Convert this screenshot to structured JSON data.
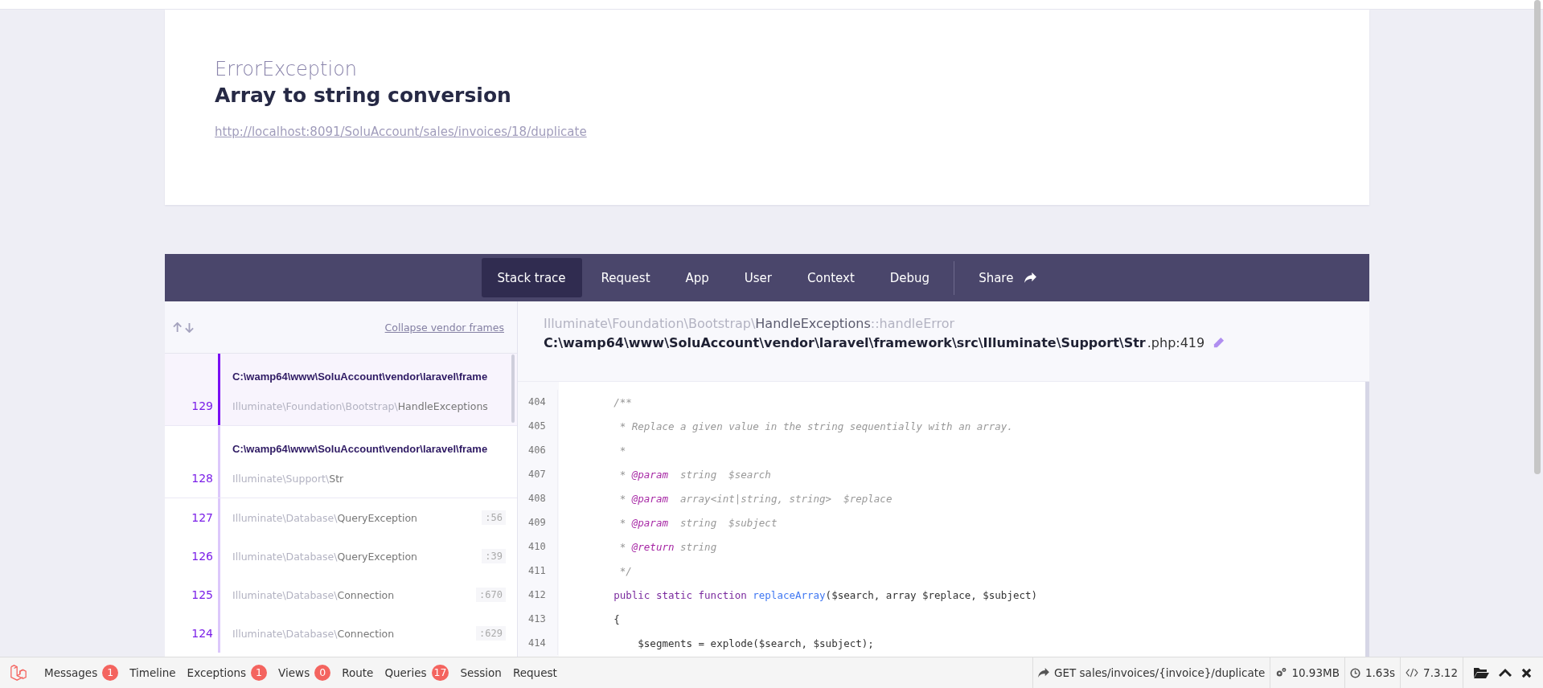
{
  "exception": {
    "class": "ErrorException",
    "message": "Array to string conversion",
    "url": "http://localhost:8091/SoluAccount/sales/invoices/18/duplicate"
  },
  "tabs": [
    {
      "label": "Stack trace",
      "selected": true
    },
    {
      "label": "Request",
      "selected": false
    },
    {
      "label": "App",
      "selected": false
    },
    {
      "label": "User",
      "selected": false
    },
    {
      "label": "Context",
      "selected": false
    },
    {
      "label": "Debug",
      "selected": false
    }
  ],
  "share": {
    "label": "Share"
  },
  "stack": {
    "collapse_link": "Collapse vendor frames",
    "frames": [
      {
        "number": "129",
        "file": "C:\\wamp64\\www\\SoluAccount\\vendor\\laravel\\frame",
        "namespace": "Illuminate\\Foundation\\Bootstrap\\",
        "class": "HandleExceptions",
        "selected": true
      },
      {
        "number": "128",
        "file": "C:\\wamp64\\www\\SoluAccount\\vendor\\laravel\\frame",
        "namespace": "Illuminate\\Support\\",
        "class": "Str",
        "selected": false
      },
      {
        "number": "127",
        "namespace": "Illuminate\\Database\\",
        "class": "QueryException",
        "line": ":56",
        "selected": false
      },
      {
        "number": "126",
        "namespace": "Illuminate\\Database\\",
        "class": "QueryException",
        "line": ":39",
        "selected": false
      },
      {
        "number": "125",
        "namespace": "Illuminate\\Database\\",
        "class": "Connection",
        "line": ":670",
        "selected": false
      },
      {
        "number": "124",
        "namespace": "Illuminate\\Database\\",
        "class": "Connection",
        "line": ":629",
        "selected": false
      }
    ]
  },
  "source": {
    "namespace": "Illuminate\\Foundation\\Bootstrap\\",
    "class": "HandleExceptions",
    "method": "::handleError",
    "path": "C:\\wamp64\\www\\SoluAccount\\vendor\\laravel\\framework\\src\\Illuminate\\Support\\Str",
    "location": ".php:419",
    "lines": [
      {
        "number": "404",
        "tokens": [
          {
            "kind": "comment",
            "text": "        /**"
          }
        ]
      },
      {
        "number": "405",
        "tokens": [
          {
            "kind": "comment",
            "text": "         * Replace a given value in the string sequentially with an array."
          }
        ]
      },
      {
        "number": "406",
        "tokens": [
          {
            "kind": "comment",
            "text": "         *"
          }
        ]
      },
      {
        "number": "407",
        "tokens": [
          {
            "kind": "comment",
            "text": "         * "
          },
          {
            "kind": "tag",
            "text": "@param"
          },
          {
            "kind": "comment",
            "text": "  string  $search"
          }
        ]
      },
      {
        "number": "408",
        "tokens": [
          {
            "kind": "comment",
            "text": "         * "
          },
          {
            "kind": "tag",
            "text": "@param"
          },
          {
            "kind": "comment",
            "text": "  array<int|string, string>  $replace"
          }
        ]
      },
      {
        "number": "409",
        "tokens": [
          {
            "kind": "comment",
            "text": "         * "
          },
          {
            "kind": "tag",
            "text": "@param"
          },
          {
            "kind": "comment",
            "text": "  string  $subject"
          }
        ]
      },
      {
        "number": "410",
        "tokens": [
          {
            "kind": "comment",
            "text": "         * "
          },
          {
            "kind": "tag",
            "text": "@return"
          },
          {
            "kind": "comment",
            "text": " string"
          }
        ]
      },
      {
        "number": "411",
        "tokens": [
          {
            "kind": "comment",
            "text": "         */"
          }
        ]
      },
      {
        "number": "412",
        "tokens": [
          {
            "kind": "keyword",
            "text": "        public static function "
          },
          {
            "kind": "function",
            "text": "replaceArray"
          },
          {
            "kind": "plain",
            "text": "($search, array $replace, $subject)"
          }
        ]
      },
      {
        "number": "413",
        "tokens": [
          {
            "kind": "plain",
            "text": "        {"
          }
        ]
      },
      {
        "number": "414",
        "tokens": [
          {
            "kind": "plain",
            "text": "            $segments = explode($search, $subject);"
          }
        ]
      }
    ]
  },
  "debugbar": {
    "tabs": [
      {
        "label": "Messages",
        "badge": "1"
      },
      {
        "label": "Timeline"
      },
      {
        "label": "Exceptions",
        "badge": "1"
      },
      {
        "label": "Views",
        "badge": "0"
      },
      {
        "label": "Route"
      },
      {
        "label": "Queries",
        "badge": "17"
      },
      {
        "label": "Session"
      },
      {
        "label": "Request"
      }
    ],
    "route": "GET sales/invoices/{invoice}/duplicate",
    "memory": "10.93MB",
    "time": "1.63s",
    "php": "7.3.12"
  }
}
